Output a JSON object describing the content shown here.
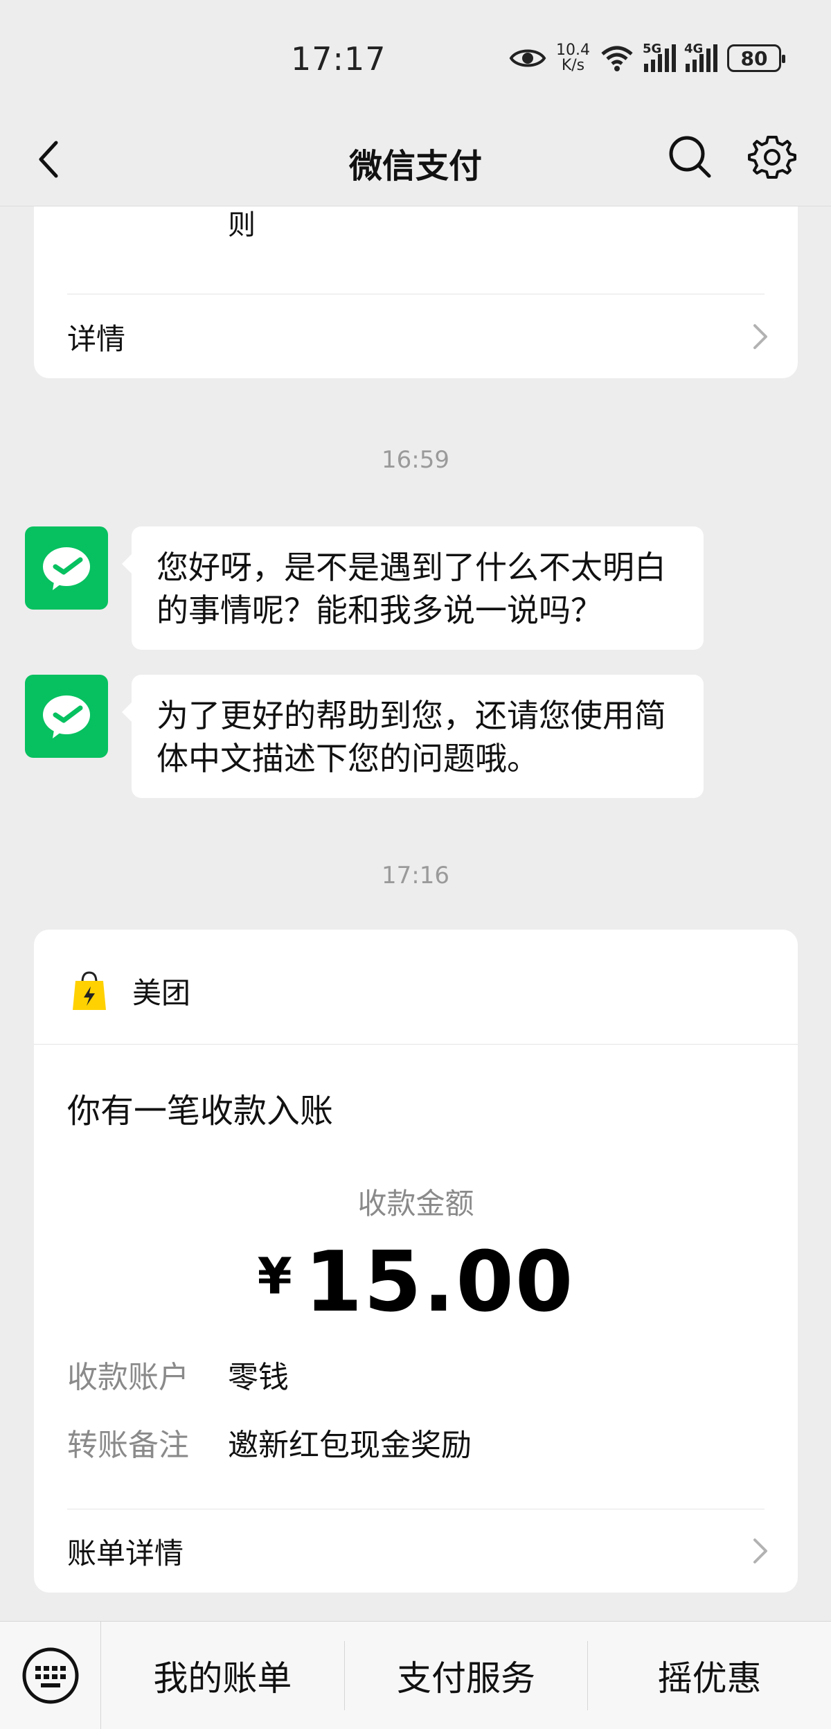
{
  "status_bar": {
    "time": "17:17",
    "net_speed_value": "10.4",
    "net_speed_unit": "K/s",
    "signal1_label": "5G",
    "signal2_label": "4G",
    "battery": "80"
  },
  "nav": {
    "title": "微信支付",
    "icons": [
      "chevron-left-icon",
      "search-icon",
      "gear-icon"
    ]
  },
  "top_card": {
    "partial_text": "则",
    "details_label": "详情"
  },
  "chat": {
    "time1": "16:59",
    "messages": [
      {
        "text": "您好呀，是不是遇到了什么不太明白的事情呢？能和我多说一说吗？"
      },
      {
        "text": "为了更好的帮助到您，还请您使用简体中文描述下您的问题哦。"
      }
    ],
    "time2": "17:16"
  },
  "payment": {
    "brand": "美团",
    "headline": "你有一笔收款入账",
    "amount_label": "收款金额",
    "currency": "¥",
    "amount": "15.00",
    "account_label": "收款账户",
    "account_value": "零钱",
    "note_label": "转账备注",
    "note_value": "邀新红包现金奖励",
    "bill_details_label": "账单详情"
  },
  "bottom_menu": {
    "items": [
      "我的账单",
      "支付服务",
      "摇优惠"
    ]
  },
  "colors": {
    "background": "#ededed",
    "wechat_green": "#07c160",
    "meituan_yellow": "#ffd100"
  }
}
